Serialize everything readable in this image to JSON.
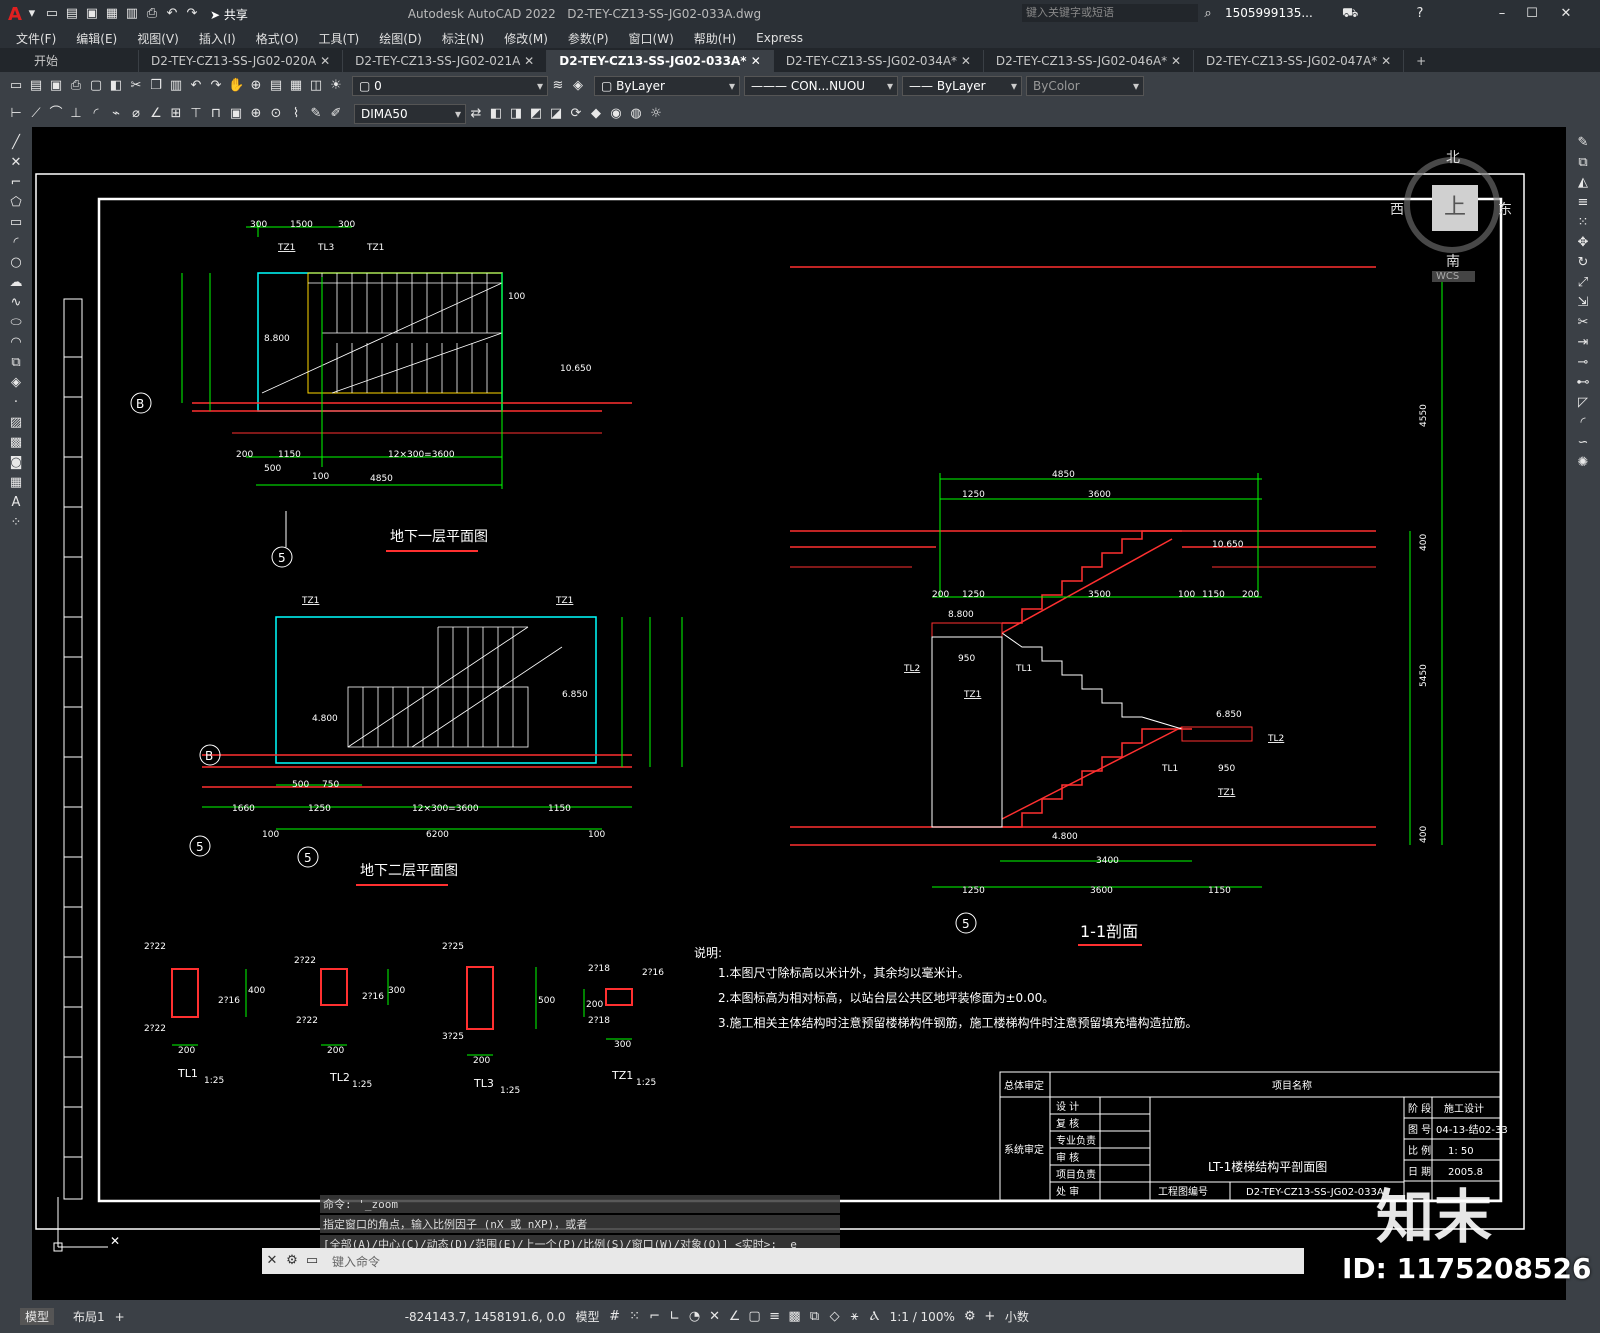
{
  "app": {
    "title": "Autodesk AutoCAD 2022",
    "file": "D2-TEY-CZ13-SS-JG02-033A.dwg",
    "share": "共享",
    "search_placeholder": "键入关键字或短语",
    "user": "1505999135..."
  },
  "menu": [
    "文件(F)",
    "编辑(E)",
    "视图(V)",
    "插入(I)",
    "格式(O)",
    "工具(T)",
    "绘图(D)",
    "标注(N)",
    "修改(M)",
    "参数(P)",
    "窗口(W)",
    "帮助(H)",
    "Express"
  ],
  "tabs": [
    "开始",
    "D2-TEY-CZ13-SS-JG02-020A",
    "D2-TEY-CZ13-SS-JG02-021A",
    "D2-TEY-CZ13-SS-JG02-033A*",
    "D2-TEY-CZ13-SS-JG02-034A*",
    "D2-TEY-CZ13-SS-JG02-046A*",
    "D2-TEY-CZ13-SS-JG02-047A*"
  ],
  "toolbar": {
    "layer": "0",
    "color": "ByLayer",
    "linetype": "CON...NUOU",
    "lineweight": "ByLayer",
    "plotstyle": "ByColor",
    "dimstyle": "DIMA50"
  },
  "viewcube": {
    "north": "北",
    "south": "南",
    "east": "东",
    "west": "西",
    "top": "上",
    "wcs": "WCS"
  },
  "drawing": {
    "plan1_title": "地下一层平面图",
    "plan2_title": "地下二层平面图",
    "section_title": "1-1剖面",
    "notes_title": "说明:",
    "notes": [
      "1.本图尺寸除标高以米计外，其余均以毫米计。",
      "2.本图标高为相对标高，以站台层公共区地坪装修面为±0.00。",
      "3.施工相关主体结构时注意预留楼梯构件钢筋，施工楼梯构件时注意预留填充墙构造拉筋。"
    ],
    "beams": [
      "TL1",
      "TL2",
      "TL3",
      "TZ1"
    ],
    "beam_scale": "1:25",
    "title_block": {
      "approve": "总体审定",
      "project": "项目名称",
      "review": "系统审定",
      "rows": [
        "设 计",
        "复 核",
        "专业负责",
        "审 核",
        "项目负责",
        "处 审"
      ],
      "drawing_name": "LT-1楼梯结构平剖面图",
      "stage_label": "阶 段",
      "stage": "施工设计",
      "no_label": "图 号",
      "no": "04-13-结02-33",
      "scale_label": "比 例",
      "scale": "1: 50",
      "date_label": "日 期",
      "date": "2005.8",
      "code_label": "工程图编号",
      "code": "D2-TEY-CZ13-SS-JG02-033A"
    }
  },
  "command": {
    "lines": [
      "命令: '_zoom",
      "指定窗口的角点，输入比例因子 (nX 或 nXP)，或者",
      "[全部(A)/中心(C)/动态(D)/范围(E)/上一个(P)/比例(S)/窗口(W)/对象(O)] <实时>: _e"
    ],
    "placeholder": "键入命令"
  },
  "layout_tabs": [
    "模型",
    "布局1"
  ],
  "status": {
    "coords": "-824143.7, 1458191.6, 0.0",
    "model": "模型",
    "scale": "1:1 / 100%",
    "units": "小数"
  },
  "watermark": {
    "logo": "知末",
    "id": "ID: 1175208526"
  }
}
